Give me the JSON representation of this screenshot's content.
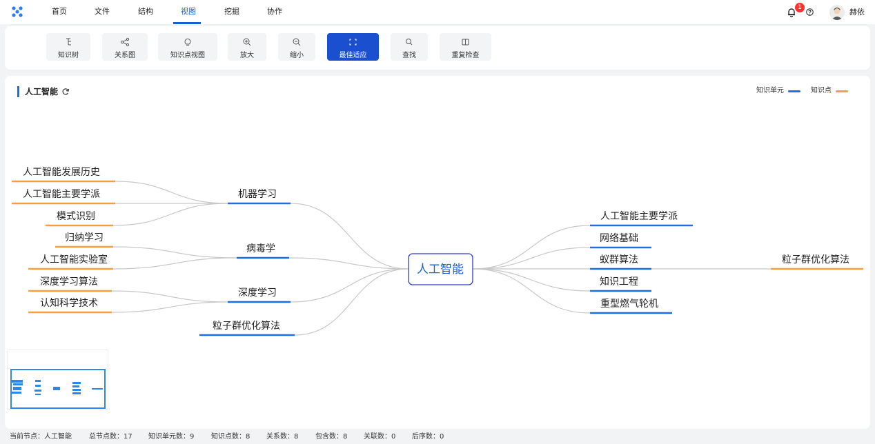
{
  "nav": {
    "items": [
      {
        "label": "首页"
      },
      {
        "label": "文件"
      },
      {
        "label": "结构"
      },
      {
        "label": "视图",
        "active": true
      },
      {
        "label": "挖掘"
      },
      {
        "label": "协作"
      }
    ],
    "notification_count": "1",
    "username": "赫依"
  },
  "toolbar": {
    "items": [
      {
        "label": "知识树",
        "icon": "tree-icon"
      },
      {
        "label": "关系图",
        "icon": "graph-icon"
      },
      {
        "label": "知识点视图",
        "icon": "bulb-icon"
      },
      {
        "label": "放大",
        "icon": "zoom-in-icon"
      },
      {
        "label": "缩小",
        "icon": "zoom-out-icon"
      },
      {
        "label": "最佳适应",
        "icon": "fit-icon",
        "active": true
      },
      {
        "label": "查找",
        "icon": "search-icon"
      },
      {
        "label": "重复检查",
        "icon": "duplicate-check-icon"
      }
    ]
  },
  "main": {
    "title": "人工智能",
    "legend": {
      "unit_label": "知识单元",
      "unit_color": "#1a6fe6",
      "point_label": "知识点",
      "point_color": "#f5a03c"
    }
  },
  "mindmap": {
    "root": "人工智能",
    "left": [
      {
        "label": "机器学习",
        "children": [
          "人工智能发展历史",
          "人工智能主要学派",
          "模式识别"
        ]
      },
      {
        "label": "病毒学",
        "children": [
          "归纳学习",
          "人工智能实验室"
        ]
      },
      {
        "label": "深度学习",
        "children": [
          "深度学习算法",
          "认知科学技术"
        ]
      },
      {
        "label": "粒子群优化算法",
        "children": []
      }
    ],
    "right": [
      {
        "label": "人工智能主要学派",
        "children": []
      },
      {
        "label": "网络基础",
        "children": []
      },
      {
        "label": "蚁群算法",
        "children": [
          "粒子群优化算法"
        ]
      },
      {
        "label": "知识工程",
        "children": []
      },
      {
        "label": "重型燃气轮机",
        "children": []
      }
    ]
  },
  "status": {
    "current": "当前节点：人工智能",
    "total": "总节点数：17",
    "units": "知识单元数：9",
    "points": "知识点数：8",
    "relations": "关系数：8",
    "contains": "包含数：8",
    "associations": "关联数：0",
    "sequences": "后序数：0"
  }
}
